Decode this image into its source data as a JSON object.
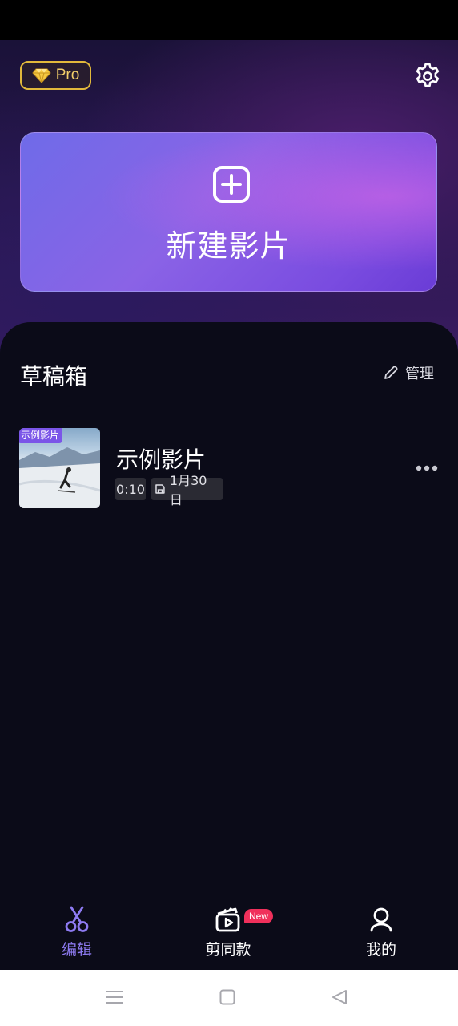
{
  "header": {
    "pro_label": "Pro",
    "pro_icon": "diamond-icon",
    "settings_icon": "gear-icon"
  },
  "new_project": {
    "label": "新建影片",
    "icon": "plus-square-icon"
  },
  "drafts": {
    "title": "草稿箱",
    "manage_label": "管理",
    "manage_icon": "pencil-icon",
    "items": [
      {
        "tag": "示例影片",
        "title": "示例影片",
        "duration": "0:10",
        "date": "1月30日",
        "date_icon": "save-icon",
        "more_icon": "more-horizontal-icon"
      }
    ]
  },
  "tabs": [
    {
      "label": "编辑",
      "icon": "scissors-icon",
      "active": true
    },
    {
      "label": "剪同款",
      "icon": "clapperboard-play-icon",
      "badge": "New"
    },
    {
      "label": "我的",
      "icon": "user-icon"
    }
  ],
  "colors": {
    "accent": "#8e7bf2",
    "pro_gold": "#e2b93b",
    "badge_red": "#f0305b",
    "background": "#0b0b18"
  }
}
